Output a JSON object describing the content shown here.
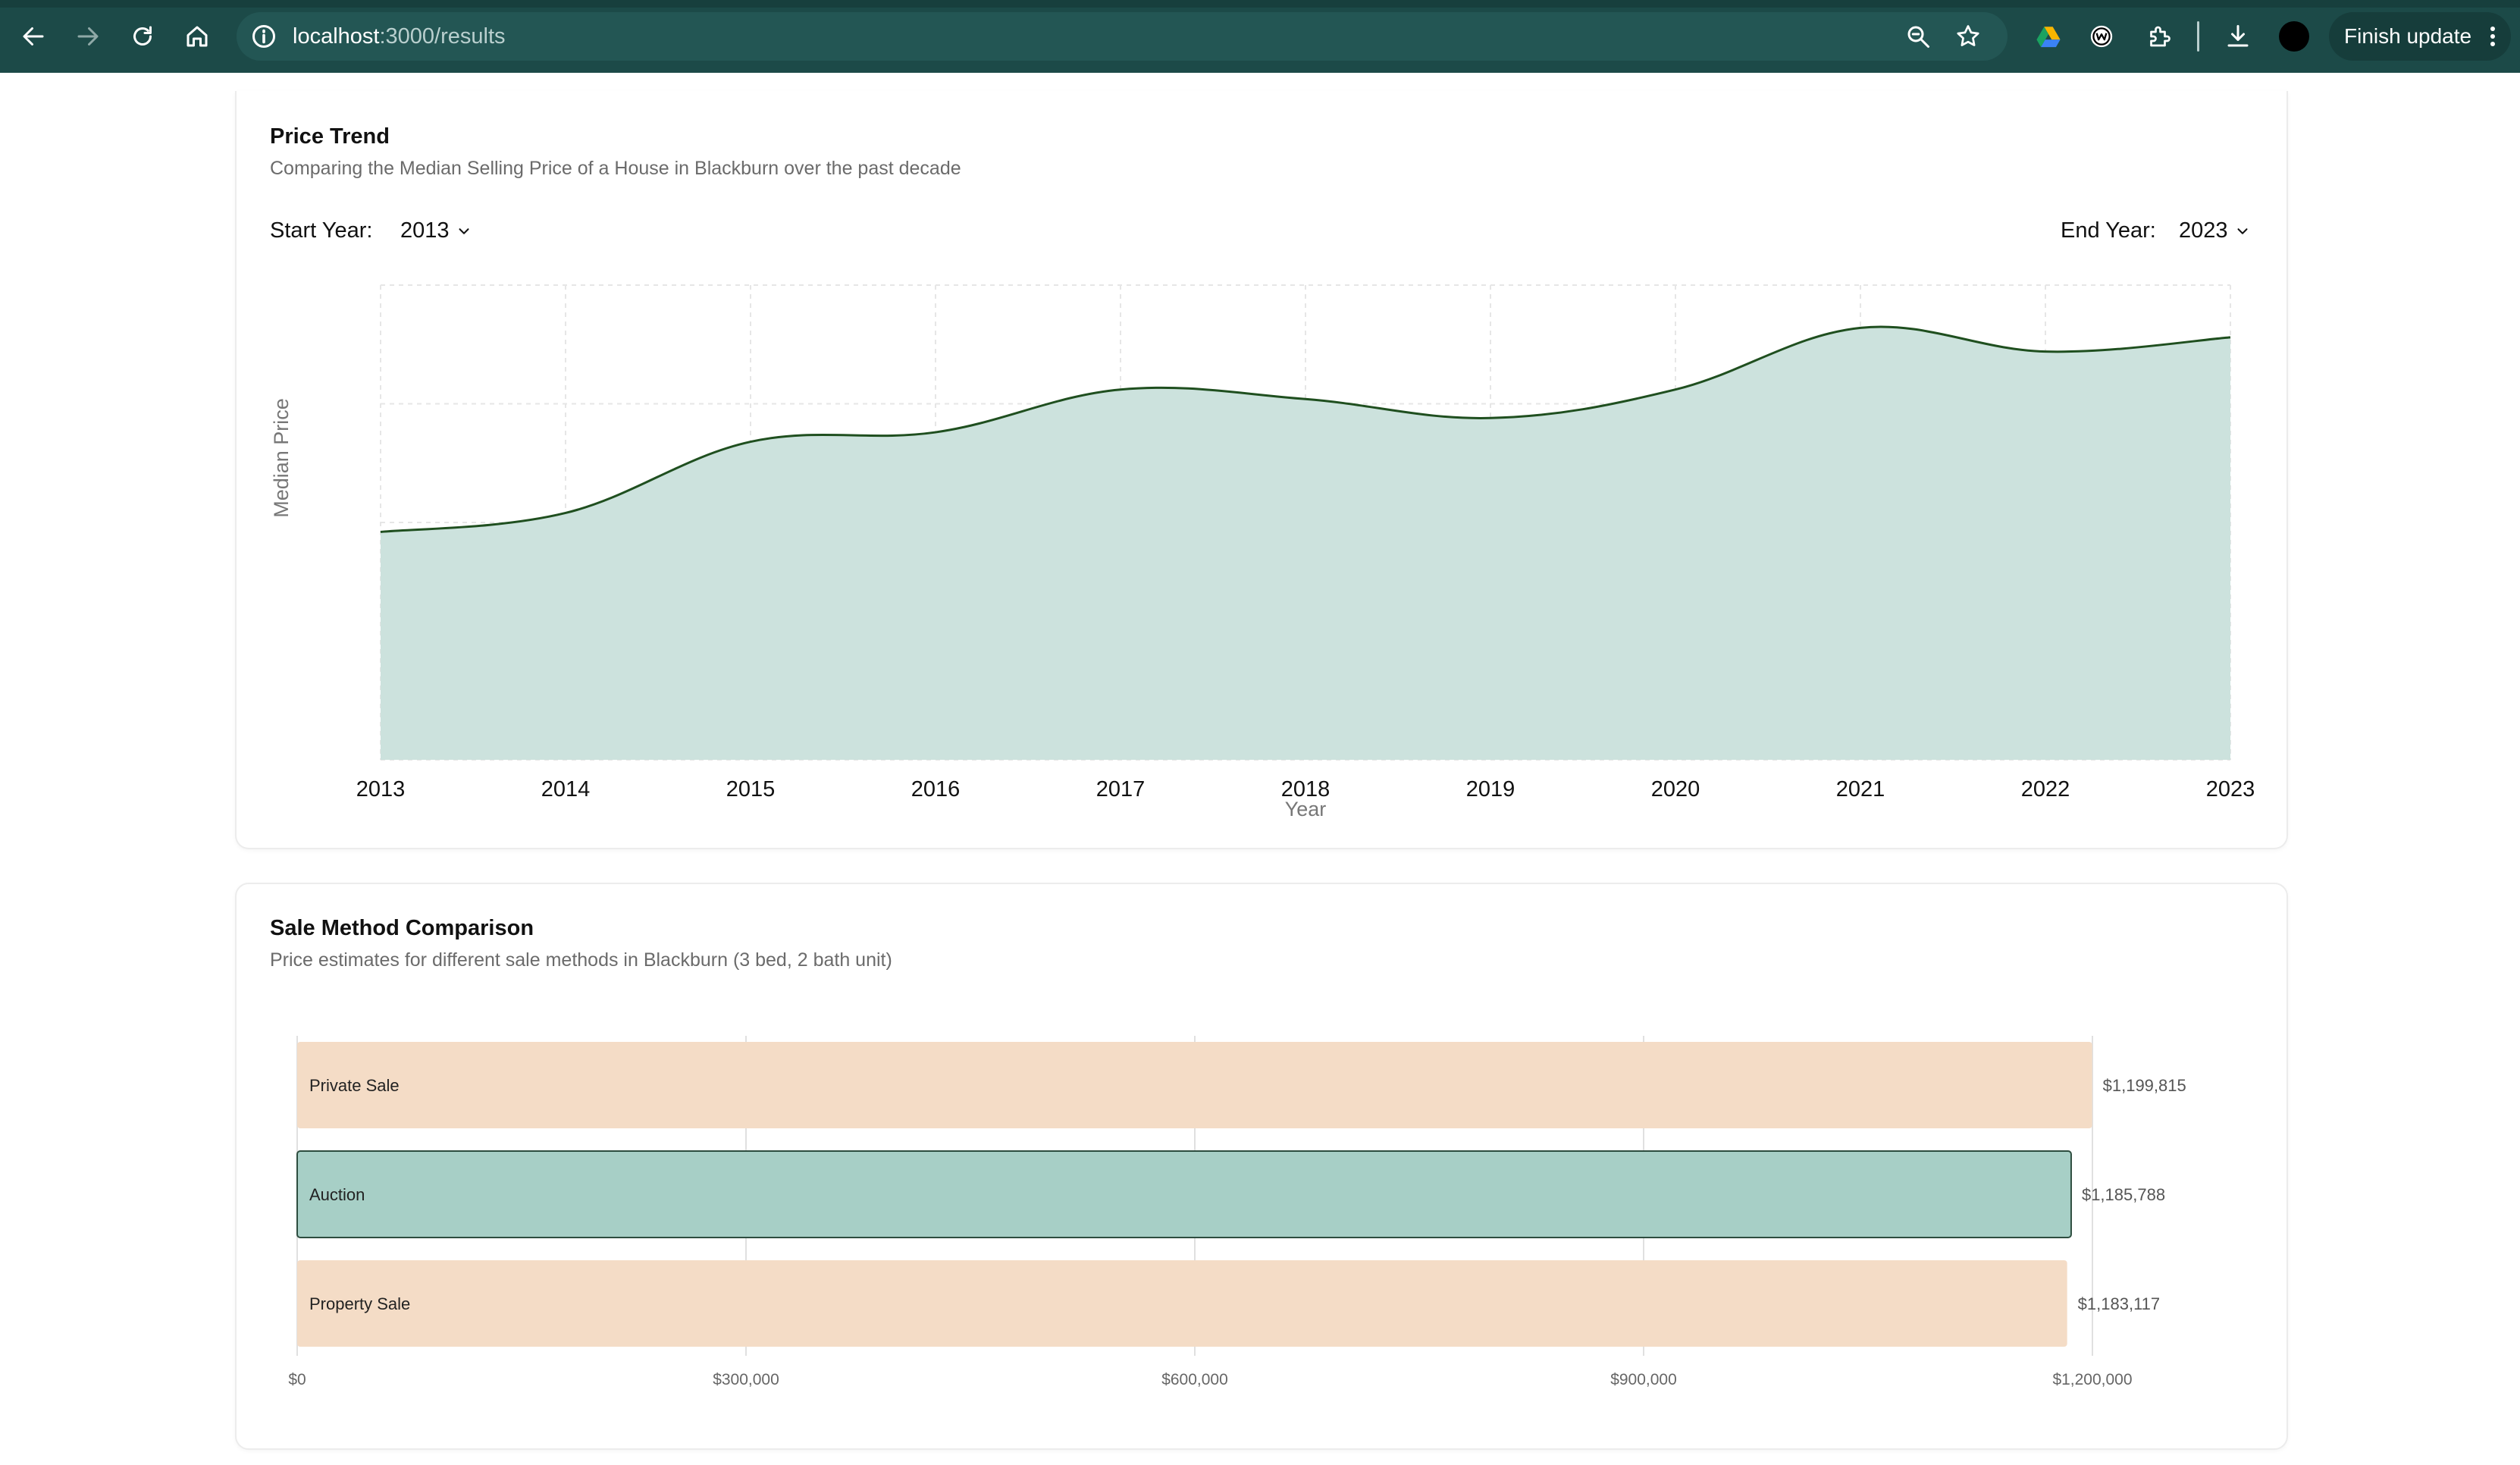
{
  "browser": {
    "url_host": "localhost",
    "url_path": ":3000/results",
    "finish_update_label": "Finish update"
  },
  "price_trend": {
    "title": "Price Trend",
    "subtitle": "Comparing the Median Selling Price of a House in Blackburn over the past decade",
    "start_label": "Start Year:",
    "start_value": "2013",
    "end_label": "End Year:",
    "end_value": "2023"
  },
  "sale_method": {
    "title": "Sale Method Comparison",
    "subtitle": "Price estimates for different sale methods in Blackburn (3 bed, 2 bath unit)"
  },
  "chart_data": [
    {
      "type": "area",
      "title": "Price Trend",
      "xlabel": "Year",
      "ylabel": "Median Price",
      "x": [
        "2013",
        "2014",
        "2015",
        "2016",
        "2017",
        "2018",
        "2019",
        "2020",
        "2021",
        "2022",
        "2023"
      ],
      "y": [
        0.48,
        0.52,
        0.67,
        0.69,
        0.78,
        0.76,
        0.72,
        0.78,
        0.91,
        0.86,
        0.89
      ],
      "ylim": [
        0,
        1
      ],
      "grid": true,
      "colors": {
        "fill": "#cce2dd",
        "line": "#1f4f1f"
      }
    },
    {
      "type": "bar",
      "orientation": "horizontal",
      "title": "Sale Method Comparison",
      "categories": [
        "Private Sale",
        "Auction",
        "Property Sale"
      ],
      "values": [
        1199815,
        1185788,
        1183117
      ],
      "value_labels": [
        "$1,199,815",
        "$1,185,788",
        "$1,183,117"
      ],
      "xlim": [
        0,
        1200000
      ],
      "x_ticks": [
        0,
        300000,
        600000,
        900000,
        1200000
      ],
      "x_tick_labels": [
        "$0",
        "$300,000",
        "$600,000",
        "$900,000",
        "$1,200,000"
      ],
      "highlight": "Auction",
      "colors": {
        "bar": "#f4dcc6",
        "highlight": "#a7cfc6",
        "highlight_border": "#2d4d3f"
      }
    }
  ]
}
